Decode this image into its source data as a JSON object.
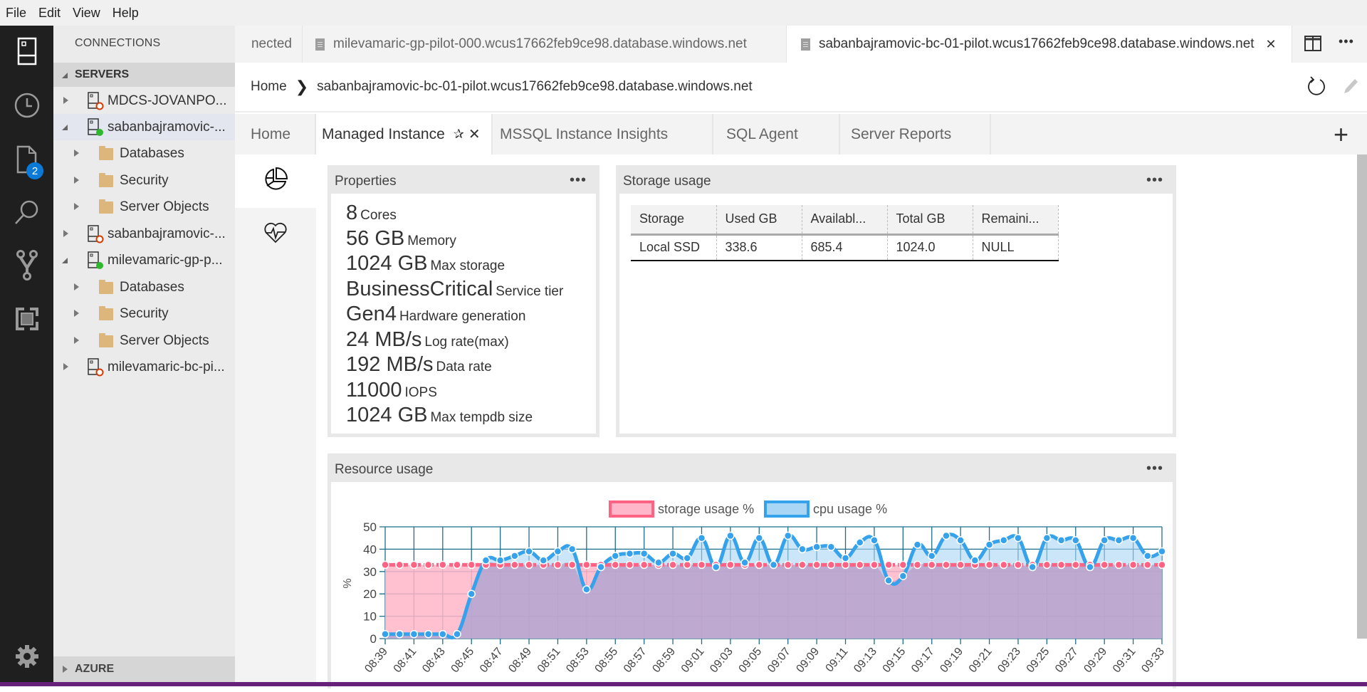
{
  "menu": [
    "File",
    "Edit",
    "View",
    "Help"
  ],
  "activity_bar": {
    "items": [
      {
        "icon": "servers-icon"
      },
      {
        "icon": "history-clock-icon"
      },
      {
        "icon": "file-explorer-icon",
        "badge": "2"
      },
      {
        "icon": "search-icon"
      },
      {
        "icon": "source-control-icon"
      },
      {
        "icon": "extensions-icon"
      }
    ],
    "settings_icon": "gear-icon"
  },
  "sidebar": {
    "title": "CONNECTIONS",
    "servers_header": "SERVERS",
    "tree": [
      {
        "label": "MDCS-JOVANPO...",
        "type": "server",
        "status": "disconnected",
        "expanded": false
      },
      {
        "label": "sabanbajramovic-...",
        "type": "server",
        "status": "connected",
        "expanded": true,
        "selected": true
      },
      {
        "label": "Databases",
        "type": "folder"
      },
      {
        "label": "Security",
        "type": "folder"
      },
      {
        "label": "Server Objects",
        "type": "folder"
      },
      {
        "label": "sabanbajramovic-...",
        "type": "server",
        "status": "disconnected",
        "expanded": false
      },
      {
        "label": "milevamaric-gp-p...",
        "type": "server",
        "status": "connected",
        "expanded": true
      },
      {
        "label": "Databases",
        "type": "folder"
      },
      {
        "label": "Security",
        "type": "folder"
      },
      {
        "label": "Server Objects",
        "type": "folder"
      },
      {
        "label": "milevamaric-bc-pi...",
        "type": "server",
        "status": "disconnected",
        "expanded": false
      }
    ],
    "azure_header": "AZURE"
  },
  "editor_tabs": [
    {
      "label": "nected",
      "active": false
    },
    {
      "label": "milevamaric-gp-pilot-000.wcus17662feb9ce98.database.windows.net",
      "active": false
    },
    {
      "label": "sabanbajramovic-bc-01-pilot.wcus17662feb9ce98.database.windows.net",
      "active": true,
      "close": "✕"
    }
  ],
  "breadcrumb": {
    "home": "Home",
    "current": "sabanbajramovic-bc-01-pilot.wcus17662feb9ce98.database.windows.net"
  },
  "dashboard_tabs": [
    {
      "label": "Home",
      "active": false
    },
    {
      "label": "Managed Instance",
      "active": true
    },
    {
      "label": "MSSQL Instance Insights",
      "active": false
    },
    {
      "label": "SQL Agent",
      "active": false
    },
    {
      "label": "Server Reports",
      "active": false
    }
  ],
  "add_tab_label": "+",
  "properties": {
    "title": "Properties",
    "menu": "•••",
    "items": [
      {
        "value": "8",
        "label": "Cores"
      },
      {
        "value": "56 GB",
        "label": "Memory"
      },
      {
        "value": "1024 GB",
        "label": "Max storage"
      },
      {
        "value": "BusinessCritical",
        "label": "Service tier"
      },
      {
        "value": "Gen4",
        "label": "Hardware generation"
      },
      {
        "value": "24 MB/s",
        "label": "Log rate(max)"
      },
      {
        "value": "192 MB/s",
        "label": "Data rate"
      },
      {
        "value": "11000",
        "label": "IOPS"
      },
      {
        "value": "1024 GB",
        "label": "Max tempdb size"
      }
    ]
  },
  "storage_usage": {
    "title": "Storage usage",
    "menu": "•••",
    "columns": [
      "Storage",
      "Used GB",
      "Availabl...",
      "Total GB",
      "Remaini..."
    ],
    "rows": [
      [
        "Local SSD",
        "338.6",
        "685.4",
        "1024.0",
        "NULL"
      ]
    ]
  },
  "resource_usage": {
    "title": "Resource usage",
    "menu": "•••"
  },
  "colors": {
    "storage_line": "#ff6384",
    "storage_fill": "#ffb6c8",
    "cpu_line": "#36a2eb",
    "cpu_fill": "#a9d6f5",
    "grid": "#1f6e8c",
    "status_bar": "#68217a",
    "accent_badge": "#0a7ad6"
  },
  "chart_data": {
    "type": "area",
    "title": "",
    "xlabel": "",
    "ylabel": "%",
    "ylim": [
      0,
      50
    ],
    "yticks": [
      0,
      10,
      20,
      30,
      40,
      50
    ],
    "grid": true,
    "legend": "top-center",
    "x": [
      "08:39",
      "08:40",
      "08:41",
      "08:42",
      "08:43",
      "08:44",
      "08:45",
      "08:46",
      "08:47",
      "08:48",
      "08:49",
      "08:50",
      "08:51",
      "08:52",
      "08:53",
      "08:54",
      "08:55",
      "08:56",
      "08:57",
      "08:58",
      "08:59",
      "09:00",
      "09:01",
      "09:02",
      "09:03",
      "09:04",
      "09:05",
      "09:06",
      "09:07",
      "09:08",
      "09:09",
      "09:10",
      "09:11",
      "09:12",
      "09:13",
      "09:14",
      "09:15",
      "09:16",
      "09:17",
      "09:18",
      "09:19",
      "09:20",
      "09:21",
      "09:22",
      "09:23",
      "09:24",
      "09:25",
      "09:26",
      "09:27",
      "09:28",
      "09:29",
      "09:30",
      "09:31",
      "09:32",
      "09:33"
    ],
    "xticks": [
      "08:39",
      "08:41",
      "08:43",
      "08:45",
      "08:47",
      "08:49",
      "08:51",
      "08:53",
      "08:55",
      "08:57",
      "08:59",
      "09:01",
      "09:03",
      "09:05",
      "09:07",
      "09:09",
      "09:11",
      "09:13",
      "09:15",
      "09:17",
      "09:19",
      "09:21",
      "09:23",
      "09:25",
      "09:27",
      "09:29",
      "09:31",
      "09:33"
    ],
    "series": [
      {
        "name": "storage usage %",
        "values": [
          33,
          33,
          33,
          33,
          33,
          33,
          33,
          33,
          33,
          33,
          33,
          33,
          33,
          33,
          33,
          33,
          33,
          33,
          33,
          33,
          33,
          33,
          33,
          33,
          33,
          33,
          33,
          33,
          33,
          33,
          33,
          33,
          33,
          33,
          33,
          33,
          33,
          33,
          33,
          33,
          33,
          33,
          33,
          33,
          33,
          33,
          33,
          33,
          33,
          33,
          33,
          33,
          33,
          33,
          33
        ]
      },
      {
        "name": "cpu usage %",
        "values": [
          2,
          2,
          2,
          2,
          2,
          2,
          20,
          35,
          35,
          37,
          39,
          35,
          39,
          40,
          22,
          32,
          37,
          38,
          38,
          34,
          38,
          36,
          45,
          32,
          46,
          34,
          45,
          33,
          46,
          40,
          41,
          41,
          36,
          43,
          44,
          26,
          28,
          42,
          37,
          46,
          44,
          35,
          42,
          44,
          45,
          32,
          45,
          44,
          44,
          32,
          44,
          44,
          45,
          37,
          39
        ]
      }
    ]
  }
}
